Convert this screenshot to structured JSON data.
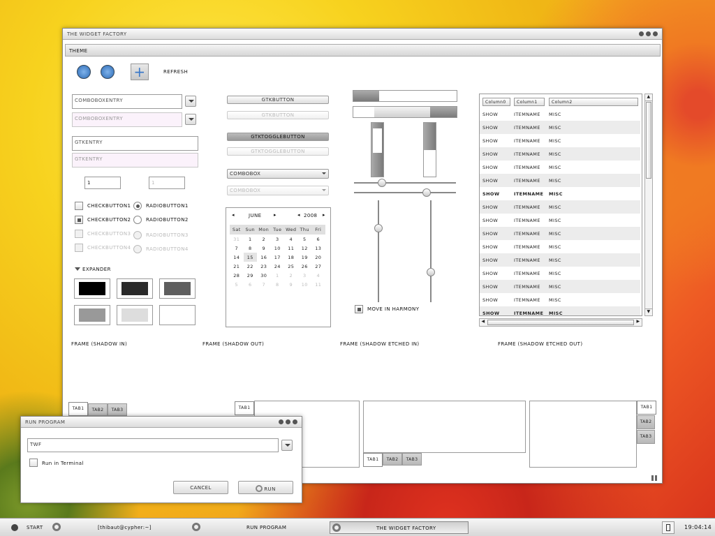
{
  "main_window": {
    "title": "The Widget Factory",
    "menu_theme": "Theme",
    "refresh_label": "Refresh"
  },
  "combos": {
    "entry1": "ComboBoxEntry",
    "entry2": "ComboBoxEntry",
    "gtkentry1": "GtkEntry",
    "gtkentry2": "GtkEntry",
    "spin1": "1",
    "spin2": "1",
    "combobox1": "ComboBox",
    "combobox2": "ComboBox"
  },
  "buttons": {
    "gtkbutton1": "GtkButton",
    "gtkbutton2": "GtkButton",
    "toggle1": "GtkToggleButton",
    "toggle2": "GtkToggleButton"
  },
  "checks": [
    "CheckButton1",
    "CheckButton2",
    "CheckButton3",
    "CheckButton4"
  ],
  "radios": [
    "RadioButton1",
    "RadioButton2",
    "RadioButton3",
    "RadioButton4"
  ],
  "expander": "Expander",
  "calendar": {
    "month": "June",
    "year": "2008",
    "days": [
      "Sat",
      "Sun",
      "Mon",
      "Tue",
      "Wed",
      "Thu",
      "Fri"
    ],
    "weeks": [
      [
        "31",
        "1",
        "2",
        "3",
        "4",
        "5",
        "6"
      ],
      [
        "7",
        "8",
        "9",
        "10",
        "11",
        "12",
        "13"
      ],
      [
        "14",
        "15",
        "16",
        "17",
        "18",
        "19",
        "20"
      ],
      [
        "21",
        "22",
        "23",
        "24",
        "25",
        "26",
        "27"
      ],
      [
        "28",
        "29",
        "30",
        "1",
        "2",
        "3",
        "4"
      ],
      [
        "5",
        "6",
        "7",
        "8",
        "9",
        "10",
        "11"
      ]
    ]
  },
  "harmony": "Move in Harmony",
  "progress": {
    "h1": 0.25,
    "h2": 0.8,
    "v1": 0.45,
    "v2": 0.5
  },
  "tree": {
    "columns": [
      "Column0",
      "Column1",
      "Column2"
    ],
    "rows": [
      [
        "Show",
        "ItemName",
        "Misc"
      ],
      [
        "Show",
        "ItemName",
        "Misc"
      ],
      [
        "Show",
        "ItemName",
        "Misc"
      ],
      [
        "Show",
        "ItemName",
        "Misc"
      ],
      [
        "Show",
        "ItemName",
        "Misc"
      ],
      [
        "Show",
        "ItemName",
        "Misc"
      ],
      [
        "Show",
        "ItemName",
        "Misc"
      ],
      [
        "Show",
        "ItemName",
        "Misc"
      ],
      [
        "Show",
        "ItemName",
        "Misc"
      ],
      [
        "Show",
        "ItemName",
        "Misc"
      ],
      [
        "Show",
        "ItemName",
        "Misc"
      ],
      [
        "Show",
        "ItemName",
        "Misc"
      ],
      [
        "Show",
        "ItemName",
        "Misc"
      ],
      [
        "Show",
        "ItemName",
        "Misc"
      ],
      [
        "Show",
        "ItemName",
        "Misc"
      ],
      [
        "Show",
        "ItemName",
        "Misc"
      ]
    ]
  },
  "frames": [
    "Frame (Shadow In)",
    "Frame (Shadow Out)",
    "Frame (Shadow Etched In)",
    "Frame (Shadow Etched Out)"
  ],
  "tabs": [
    "Tab1",
    "Tab2",
    "Tab3"
  ],
  "run_dialog": {
    "title": "Run Program",
    "command": "twf",
    "terminal_label": "Run in Terminal",
    "cancel": "Cancel",
    "run": "Run"
  },
  "taskbar": {
    "start": "Start",
    "item1": "[thibaut@cypher:~]",
    "item2": "Run Program",
    "item3": "The Widget Factory",
    "clock": "19:04:14"
  }
}
